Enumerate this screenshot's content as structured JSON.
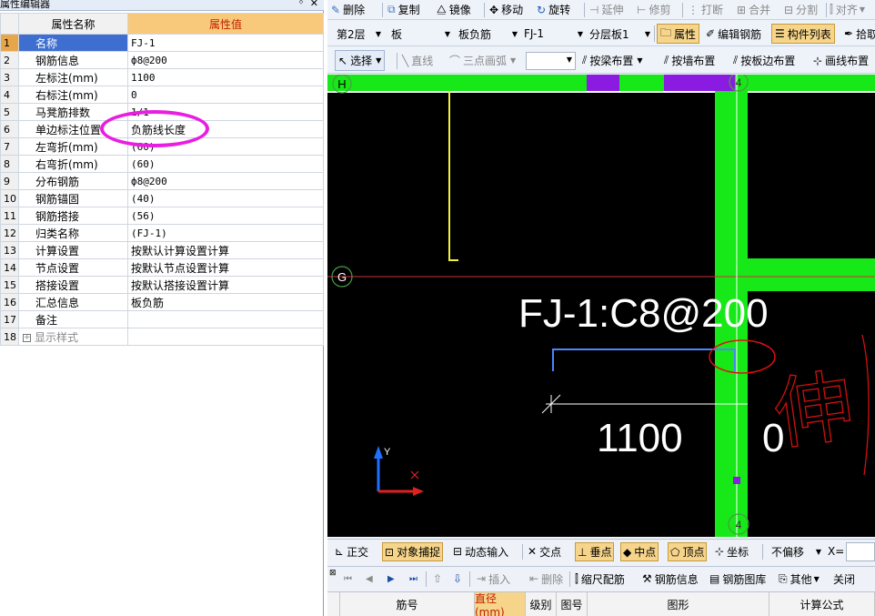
{
  "property_panel": {
    "title": "属性编辑器",
    "pin_icon": "pin-icon",
    "close_icon": "close-icon",
    "header_name": "属性名称",
    "header_value": "属性值",
    "rows": [
      {
        "num": "1",
        "name": "名称",
        "value": "FJ-1"
      },
      {
        "num": "2",
        "name": "钢筋信息",
        "value": "ф8@200"
      },
      {
        "num": "3",
        "name": "左标注(mm)",
        "value": "1100"
      },
      {
        "num": "4",
        "name": "右标注(mm)",
        "value": "0"
      },
      {
        "num": "5",
        "name": "马凳筋排数",
        "value": "1/1"
      },
      {
        "num": "6",
        "name": "单边标注位置",
        "value": "负筋线长度"
      },
      {
        "num": "7",
        "name": "左弯折(mm)",
        "value": "(60)"
      },
      {
        "num": "8",
        "name": "右弯折(mm)",
        "value": "(60)"
      },
      {
        "num": "9",
        "name": "分布钢筋",
        "value": "ф8@200"
      },
      {
        "num": "10",
        "name": "钢筋锚固",
        "value": "(40)"
      },
      {
        "num": "11",
        "name": "钢筋搭接",
        "value": "(56)"
      },
      {
        "num": "12",
        "name": "归类名称",
        "value": "(FJ-1)"
      },
      {
        "num": "13",
        "name": "计算设置",
        "value": "按默认计算设置计算"
      },
      {
        "num": "14",
        "name": "节点设置",
        "value": "按默认节点设置计算"
      },
      {
        "num": "15",
        "name": "搭接设置",
        "value": "按默认搭接设置计算"
      },
      {
        "num": "16",
        "name": "汇总信息",
        "value": "板负筋"
      },
      {
        "num": "17",
        "name": "备注",
        "value": ""
      },
      {
        "num": "18",
        "name": "显示样式",
        "value": ""
      }
    ]
  },
  "toolbar1": {
    "delete": "删除",
    "copy": "复制",
    "mirror": "镜像",
    "move": "移动",
    "rotate": "旋转",
    "extend": "延伸",
    "trim": "修剪",
    "break": "打断",
    "merge": "合并",
    "split": "分割",
    "align": "对齐"
  },
  "toolbar2": {
    "floor": "第2层",
    "category": "板",
    "type": "板负筋",
    "component": "FJ-1",
    "layer": "分层板1",
    "properties": "属性",
    "edit_rebar": "编辑钢筋",
    "component_list": "构件列表",
    "pick": "拾取"
  },
  "toolbar3": {
    "select": "选择",
    "line": "直线",
    "arc": "三点画弧",
    "by_beam": "按梁布置",
    "by_wall": "按墙布置",
    "by_slab_edge": "按板边布置",
    "draw_line": "画线布置"
  },
  "canvas": {
    "axis_h": "H",
    "axis_g": "G",
    "axis_4_top": "4",
    "axis_4_bottom": "4",
    "rebar_label": "FJ-1:C8@200",
    "left_dim": "1100",
    "right_dim": "0",
    "y_axis": "Y",
    "handwriting": "伸"
  },
  "status_bar": {
    "ortho": "正交",
    "snap": "对象捕捉",
    "dynamic_input": "动态输入",
    "intersection": "交点",
    "perpendicular": "垂点",
    "midpoint": "中点",
    "vertex": "顶点",
    "coordinate": "坐标",
    "offset_mode": "不偏移",
    "x_label": "X="
  },
  "grid_toolbar": {
    "insert": "插入",
    "delete": "删除",
    "scale_rebar": "缩尺配筋",
    "rebar_info": "钢筋信息",
    "rebar_library": "钢筋图库",
    "other": "其他",
    "close": "关闭"
  },
  "grid_header": {
    "bar_no": "筋号",
    "diameter": "直径(mm)",
    "grade": "级别",
    "shape_no": "图号",
    "shape": "图形",
    "formula": "计算公式"
  }
}
